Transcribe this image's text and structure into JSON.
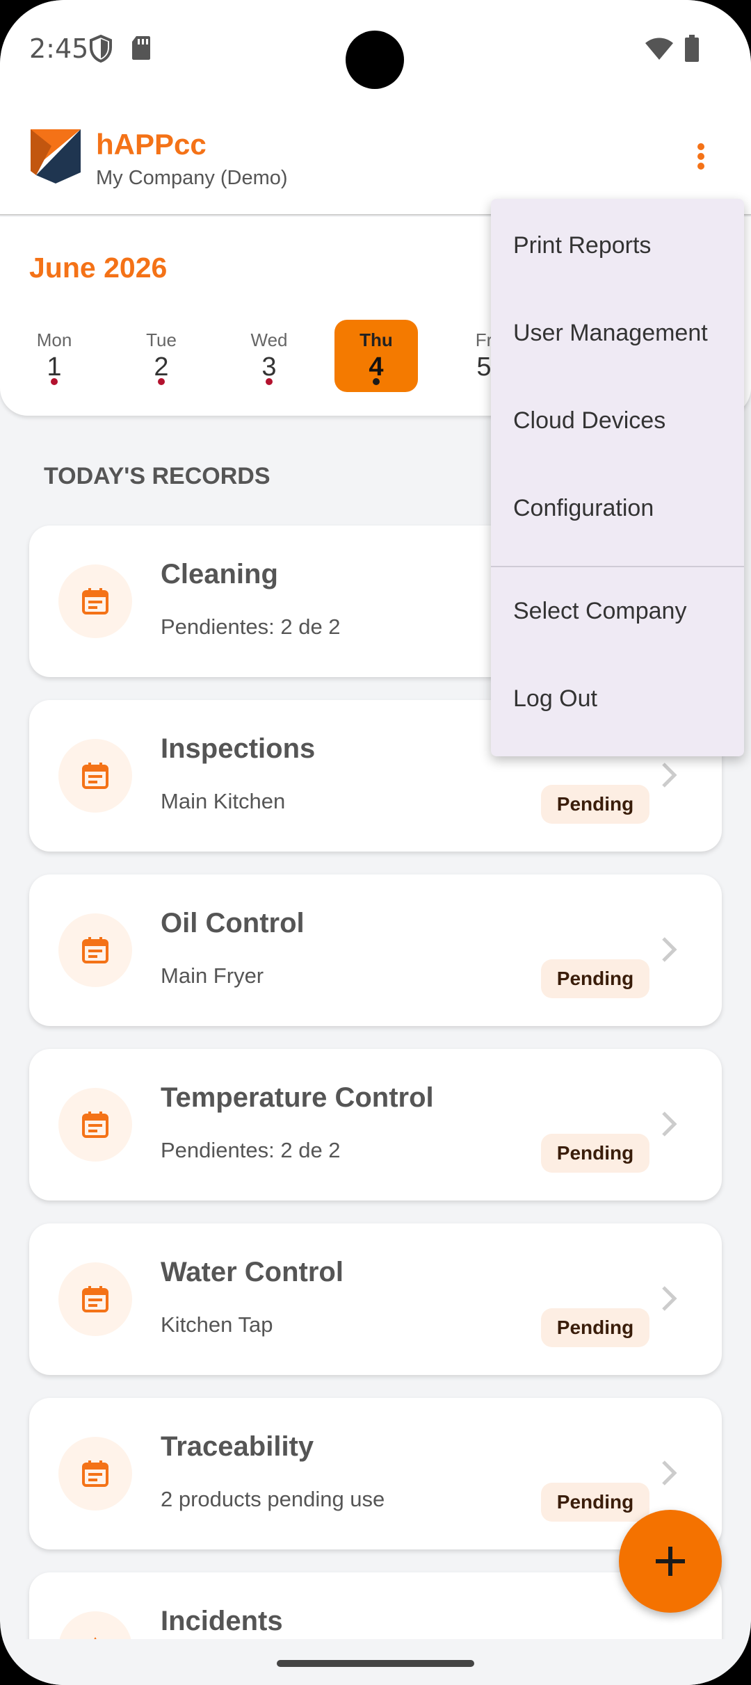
{
  "status_bar": {
    "time": "2:45",
    "icons": [
      "shield-icon",
      "sd-card-icon",
      "wifi-icon",
      "battery-icon"
    ]
  },
  "app_bar": {
    "title": "hAPPcc",
    "subtitle": "My Company (Demo)",
    "overflow_icon": "more-vert-icon"
  },
  "calendar": {
    "month": "June 2026",
    "days": [
      {
        "name": "Mon",
        "date": "1"
      },
      {
        "name": "Tue",
        "date": "2"
      },
      {
        "name": "Wed",
        "date": "3"
      },
      {
        "name": "Thu",
        "date": "4",
        "selected": true
      },
      {
        "name": "Fr",
        "date": "5"
      }
    ]
  },
  "section_title": "TODAY'S RECORDS",
  "records": [
    {
      "title": "Cleaning",
      "subtitle": "Pendientes: 2 de 2",
      "status": ""
    },
    {
      "title": "Inspections",
      "subtitle": "Main Kitchen",
      "status": "Pending"
    },
    {
      "title": "Oil Control",
      "subtitle": "Main Fryer",
      "status": "Pending"
    },
    {
      "title": "Temperature Control",
      "subtitle": "Pendientes: 2 de 2",
      "status": "Pending"
    },
    {
      "title": "Water Control",
      "subtitle": "Kitchen Tap",
      "status": "Pending"
    },
    {
      "title": "Traceability",
      "subtitle": "2 products pending use",
      "status": "Pending"
    },
    {
      "title": "Incidents",
      "subtitle": "",
      "status": ""
    }
  ],
  "menu": {
    "items": [
      "Print Reports",
      "User Management",
      "Cloud Devices",
      "Configuration",
      "Select Company",
      "Log Out"
    ]
  },
  "colors": {
    "accent": "#f47217",
    "badge_bg": "#fdeee3",
    "menu_bg": "#efeaf4"
  }
}
